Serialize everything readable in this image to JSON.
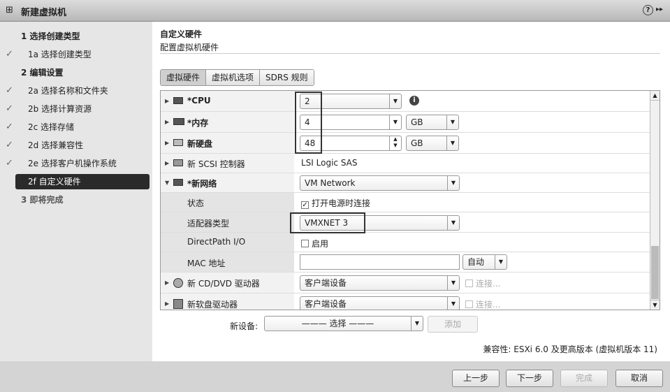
{
  "window": {
    "title": "新建虚拟机",
    "help_icon": "?",
    "expand_icon": "▸▸"
  },
  "steps": [
    {
      "label": "1  选择创建类型",
      "type": "h",
      "check": false
    },
    {
      "label": "1a 选择创建类型",
      "type": "s",
      "check": true
    },
    {
      "label": "2  编辑设置",
      "type": "h",
      "check": false
    },
    {
      "label": "2a 选择名称和文件夹",
      "type": "s",
      "check": true
    },
    {
      "label": "2b 选择计算资源",
      "type": "s",
      "check": true
    },
    {
      "label": "2c 选择存储",
      "type": "s",
      "check": true
    },
    {
      "label": "2d 选择兼容性",
      "type": "s",
      "check": true
    },
    {
      "label": "2e 选择客户机操作系统",
      "type": "s",
      "check": true
    },
    {
      "label": "2f 自定义硬件",
      "type": "sel",
      "check": false
    },
    {
      "label": "3  即将完成",
      "type": "h",
      "check": false
    }
  ],
  "main": {
    "title": "自定义硬件",
    "subtitle": "配置虚拟机硬件",
    "tabs": [
      "虚拟硬件",
      "虚拟机选项",
      "SDRS 规则"
    ],
    "hardware": {
      "cpu": {
        "label": "*CPU",
        "value": "2"
      },
      "memory": {
        "label": "*内存",
        "value": "4",
        "unit": "GB"
      },
      "disk": {
        "label": "新硬盘",
        "value": "48",
        "unit": "GB"
      },
      "scsi": {
        "label": "新 SCSI 控制器",
        "value": "LSI Logic SAS"
      },
      "network": {
        "label": "*新网络",
        "value": "VM Network"
      },
      "status": {
        "label": "状态",
        "value": "打开电源时连接",
        "checked": true
      },
      "adapter": {
        "label": "适配器类型",
        "value": "VMXNET 3"
      },
      "directpath": {
        "label": "DirectPath I/O",
        "value": "启用",
        "checked": false
      },
      "mac": {
        "label": "MAC 地址",
        "value": "",
        "mode": "自动"
      },
      "cddvd": {
        "label": "新 CD/DVD 驱动器",
        "value": "客户端设备",
        "connect": "连接..."
      },
      "floppy": {
        "label": "新软盘驱动器",
        "value": "客户端设备",
        "connect": "连接..."
      }
    },
    "new_device": {
      "label": "新设备:",
      "value": "——— 选择 ———",
      "add": "添加"
    },
    "compat": "兼容性: ESXi 6.0 及更高版本 (虚拟机版本 11)"
  },
  "footer": {
    "back": "上一步",
    "next": "下一步",
    "finish": "完成",
    "cancel": "取消"
  }
}
